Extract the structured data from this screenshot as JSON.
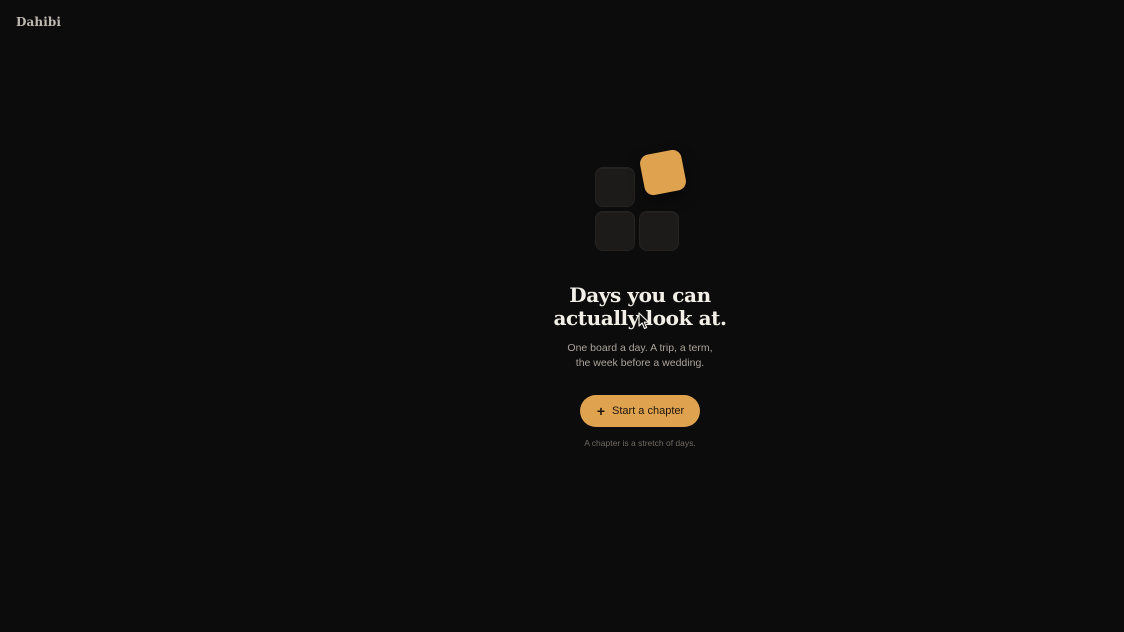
{
  "app": {
    "brand": "Dahibi"
  },
  "hero": {
    "headline_line1": "Days you can",
    "headline_line2": "actually look at.",
    "subtitle_line1": "One board a day. A trip, a term,",
    "subtitle_line2": "the week before a wedding.",
    "cta_label": "Start a chapter",
    "cta_icon": "plus-icon",
    "note": "A chapter is a stretch of days."
  },
  "colors": {
    "background": "#0d0c0c",
    "accent": "#dfa24f",
    "tile": "#1c1b1a"
  }
}
